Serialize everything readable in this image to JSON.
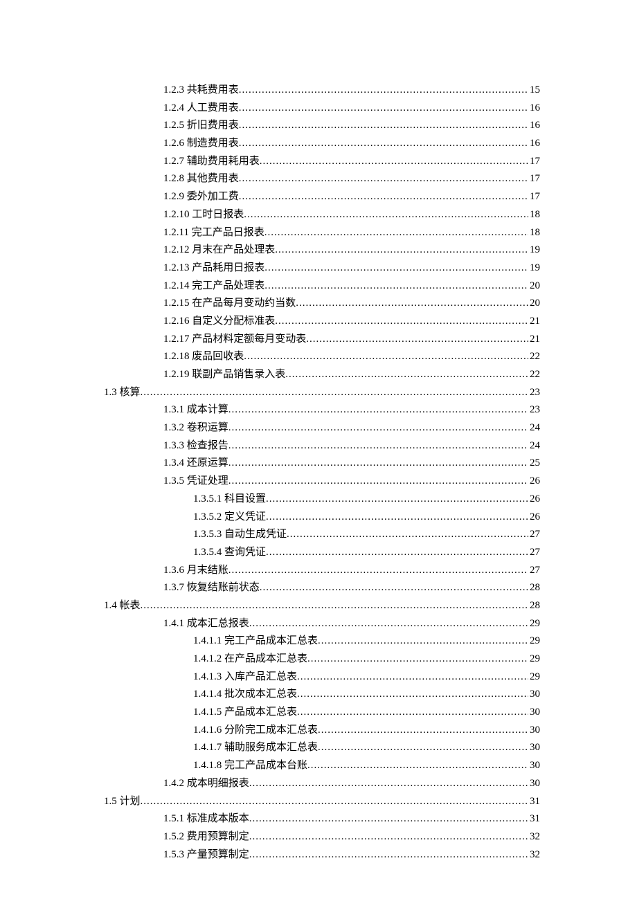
{
  "toc": [
    {
      "level": 1,
      "num": "1.2.3",
      "title": "共耗费用表",
      "page": "15"
    },
    {
      "level": 1,
      "num": "1.2.4",
      "title": "人工费用表",
      "page": "16"
    },
    {
      "level": 1,
      "num": "1.2.5",
      "title": "折旧费用表",
      "page": "16"
    },
    {
      "level": 1,
      "num": "1.2.6",
      "title": "制造费用表",
      "page": "16"
    },
    {
      "level": 1,
      "num": "1.2.7",
      "title": "辅助费用耗用表",
      "page": "17"
    },
    {
      "level": 1,
      "num": "1.2.8",
      "title": "其他费用表",
      "page": "17"
    },
    {
      "level": 1,
      "num": "1.2.9",
      "title": "委外加工费",
      "page": "17"
    },
    {
      "level": 1,
      "num": "1.2.10",
      "title": "工时日报表",
      "page": "18"
    },
    {
      "level": 1,
      "num": "1.2.11",
      "title": "完工产品日报表",
      "page": "18"
    },
    {
      "level": 1,
      "num": "1.2.12",
      "title": "月末在产品处理表",
      "page": "19"
    },
    {
      "level": 1,
      "num": "1.2.13",
      "title": "产品耗用日报表",
      "page": "19"
    },
    {
      "level": 1,
      "num": "1.2.14",
      "title": "完工产品处理表",
      "page": "20"
    },
    {
      "level": 1,
      "num": "1.2.15",
      "title": "在产品每月变动约当数",
      "page": "20"
    },
    {
      "level": 1,
      "num": "1.2.16",
      "title": "自定义分配标准表",
      "page": "21"
    },
    {
      "level": 1,
      "num": "1.2.17",
      "title": "产品材料定额每月变动表",
      "page": "21"
    },
    {
      "level": 1,
      "num": "1.2.18",
      "title": "废品回收表",
      "page": "22"
    },
    {
      "level": 1,
      "num": "1.2.19",
      "title": "联副产品销售录入表",
      "page": "22"
    },
    {
      "level": 0,
      "num": "1.3",
      "title": "核算",
      "page": "23"
    },
    {
      "level": 1,
      "num": "1.3.1",
      "title": "成本计算",
      "page": "23"
    },
    {
      "level": 1,
      "num": "1.3.2",
      "title": "卷积运算",
      "page": "24"
    },
    {
      "level": 1,
      "num": "1.3.3",
      "title": "检查报告",
      "page": "24"
    },
    {
      "level": 1,
      "num": "1.3.4",
      "title": "还原运算",
      "page": "25"
    },
    {
      "level": 1,
      "num": "1.3.5",
      "title": "凭证处理",
      "page": "26"
    },
    {
      "level": 2,
      "num": "1.3.5.1",
      "title": "科目设置",
      "page": "26"
    },
    {
      "level": 2,
      "num": "1.3.5.2",
      "title": "定义凭证",
      "page": "26"
    },
    {
      "level": 2,
      "num": "1.3.5.3",
      "title": "自动生成凭证",
      "page": "27"
    },
    {
      "level": 2,
      "num": "1.3.5.4",
      "title": "查询凭证",
      "page": "27"
    },
    {
      "level": 1,
      "num": "1.3.6",
      "title": "月末结账",
      "page": "27"
    },
    {
      "level": 1,
      "num": "1.3.7",
      "title": "恢复结账前状态",
      "page": "28"
    },
    {
      "level": 0,
      "num": "1.4",
      "title": "帐表",
      "page": "28"
    },
    {
      "level": 1,
      "num": "1.4.1",
      "title": "成本汇总报表",
      "page": "29"
    },
    {
      "level": 2,
      "num": "1.4.1.1",
      "title": "完工产品成本汇总表",
      "page": "29"
    },
    {
      "level": 2,
      "num": "1.4.1.2",
      "title": "在产品成本汇总表",
      "page": "29"
    },
    {
      "level": 2,
      "num": "1.4.1.3",
      "title": "入库产品汇总表",
      "page": "29"
    },
    {
      "level": 2,
      "num": "1.4.1.4",
      "title": "批次成本汇总表",
      "page": "30"
    },
    {
      "level": 2,
      "num": "1.4.1.5",
      "title": "产品成本汇总表",
      "page": "30"
    },
    {
      "level": 2,
      "num": "1.4.1.6",
      "title": "分阶完工成本汇总表",
      "page": "30"
    },
    {
      "level": 2,
      "num": "1.4.1.7",
      "title": "辅助服务成本汇总表",
      "page": "30"
    },
    {
      "level": 2,
      "num": "1.4.1.8",
      "title": "完工产品成本台账",
      "page": "30"
    },
    {
      "level": 1,
      "num": "1.4.2",
      "title": "成本明细报表",
      "page": "30"
    },
    {
      "level": 0,
      "num": "1.5",
      "title": "计划",
      "page": "31"
    },
    {
      "level": 1,
      "num": "1.5.1",
      "title": "标准成本版本",
      "page": "31"
    },
    {
      "level": 1,
      "num": "1.5.2",
      "title": "费用预算制定",
      "page": "32"
    },
    {
      "level": 1,
      "num": "1.5.3",
      "title": "产量预算制定",
      "page": "32"
    }
  ]
}
